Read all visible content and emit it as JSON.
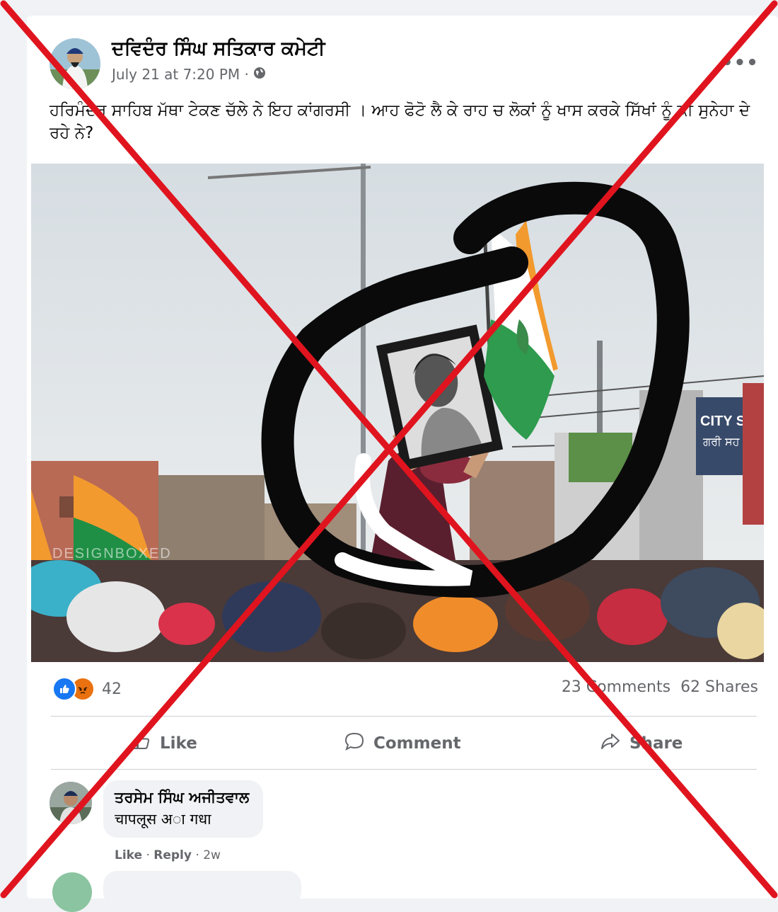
{
  "post": {
    "page_name": "ਦਵਿਦੰਰ ਸਿੰਘ ਸਤਿਕਾਰ ਕਮੇਟੀ",
    "timestamp": "July 21 at 7:20 PM ·",
    "privacy_icon": "globe-icon",
    "more_label": "•••",
    "text": "ਹਰਿਮੰਦਰ  ਸਾਹਿਬ ਮੱਥਾ ਟੇਕਣ ਚੱਲੇ ਨੇ ਇਹ ਕਾਂਗਰਸੀ । ਆਹ ਫੋਟੋ ਲੈ ਕੇ ਰਾਹ ਚ ਲੋਕਾਂ ਨੂੰ ਖਾਸ ਕਰਕੇ ਸਿੱਖਾਂ ਨੂੰ ਕੀ ਸੁਨੇਹਾ ਦੇ ਰਹੇ ਨੇ?"
  },
  "photo": {
    "watermark": "DESIGNBOXED",
    "banner_text": "CITY SCA",
    "banner_text_2": "ਗਰੀ ਸਹ"
  },
  "stats": {
    "reaction_count": "42",
    "comments": "23 Comments",
    "shares": "62 Shares"
  },
  "actions": {
    "like": "Like",
    "comment": "Comment",
    "share": "Share"
  },
  "comment": {
    "author": "ਤਰਸੇਮ ਸਿੰਘ ਅਜੀਤਵਾਲ",
    "text": "चापलूस अ◌ा गधा",
    "like": "Like",
    "reply": "Reply",
    "age": "2w"
  },
  "colors": {
    "cross": "#e0141e",
    "like_blue": "#1877f2",
    "angry_orange": "#e9710f",
    "secondary_text": "#65676b"
  }
}
